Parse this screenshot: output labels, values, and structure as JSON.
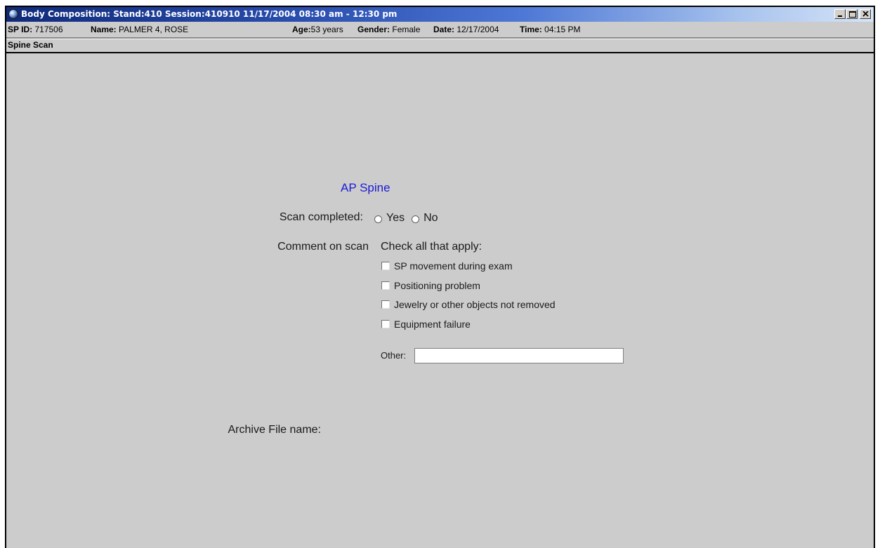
{
  "window": {
    "title": "Body Composition: Stand:410 Session:410910 11/17/2004 08:30 am - 12:30 pm",
    "icon": "globe-icon",
    "controls": [
      "minimize-icon",
      "maximize-icon",
      "close-icon"
    ]
  },
  "participant": {
    "sp_id_label": "SP ID:",
    "sp_id": "717506",
    "name_label": "Name:",
    "name": "PALMER 4, ROSE",
    "age_label": "Age:",
    "age": "53 years",
    "gender_label": "Gender:",
    "gender": "Female",
    "date_label": "Date:",
    "date": "12/17/2004",
    "time_label": "Time:",
    "time": "04:15 PM"
  },
  "section": {
    "title": "Spine Scan"
  },
  "form": {
    "heading": "AP Spine",
    "scan_completed_label": "Scan completed:",
    "scan_completed_options": [
      "Yes",
      "No"
    ],
    "comment_label": "Comment on scan",
    "check_all_label": "Check all that apply:",
    "checkboxes": [
      "SP movement during exam",
      "Positioning problem",
      "Jewelry or other objects not removed",
      "Equipment failure"
    ],
    "other_label": "Other:",
    "other_value": "",
    "archive_label": "Archive File name:"
  },
  "colors": {
    "heading": "#1a1ad6",
    "background": "#cccccc",
    "titlebar_start": "#102a7a",
    "titlebar_end": "#d6e4f8"
  }
}
